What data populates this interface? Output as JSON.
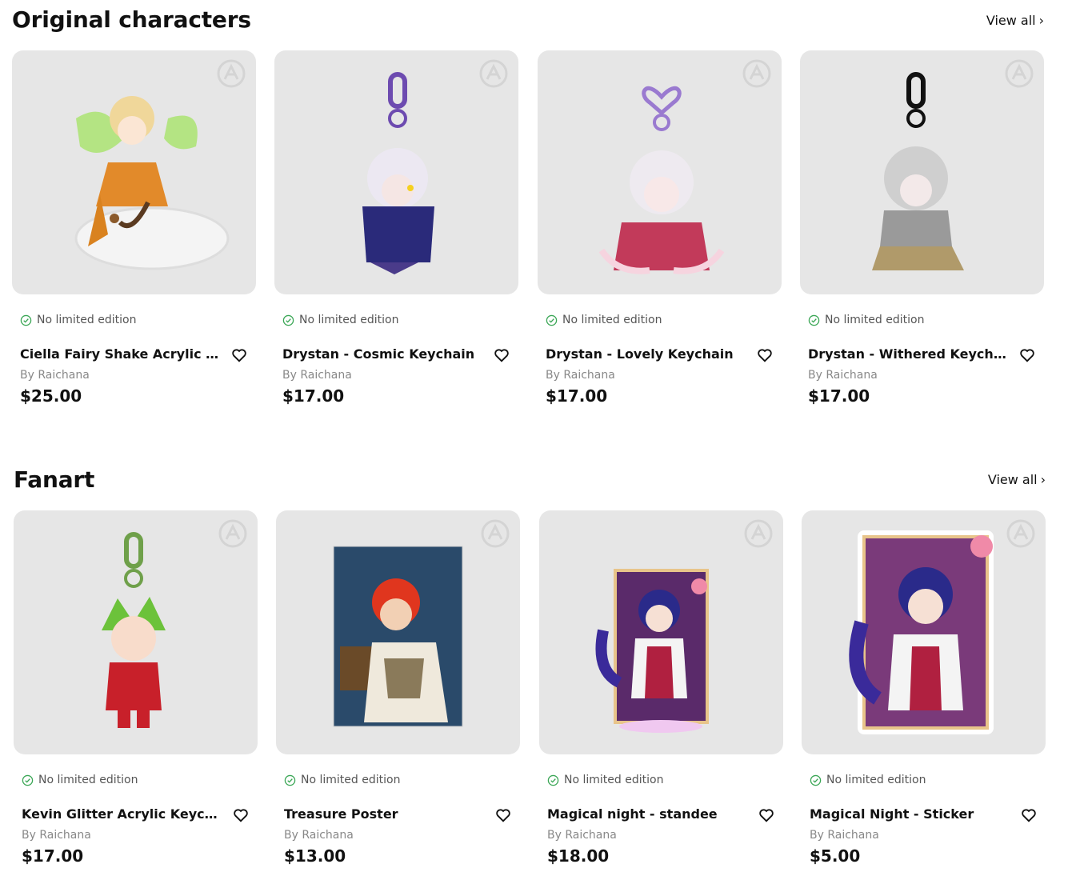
{
  "sections": [
    {
      "title": "Original characters",
      "view_all": "View all",
      "products": [
        {
          "edition": "No limited edition",
          "title": "Ciella Fairy Shake Acrylic St...",
          "by": "By Raichana",
          "price": "$25.00"
        },
        {
          "edition": "No limited edition",
          "title": "Drystan - Cosmic Keychain",
          "by": "By Raichana",
          "price": "$17.00"
        },
        {
          "edition": "No limited edition",
          "title": "Drystan - Lovely Keychain",
          "by": "By Raichana",
          "price": "$17.00"
        },
        {
          "edition": "No limited edition",
          "title": "Drystan - Withered Keychain",
          "by": "By Raichana",
          "price": "$17.00"
        }
      ]
    },
    {
      "title": "Fanart",
      "view_all": "View all",
      "products": [
        {
          "edition": "No limited edition",
          "title": "Kevin Glitter Acrylic Keychai...",
          "by": "By Raichana",
          "price": "$17.00"
        },
        {
          "edition": "No limited edition",
          "title": "Treasure Poster",
          "by": "By Raichana",
          "price": "$13.00"
        },
        {
          "edition": "No limited edition",
          "title": "Magical night - standee",
          "by": "By Raichana",
          "price": "$18.00"
        },
        {
          "edition": "No limited edition",
          "title": "Magical Night - Sticker",
          "by": "By Raichana",
          "price": "$5.00"
        }
      ]
    }
  ],
  "icons": {
    "edition_check": "check-circle-icon",
    "favorite": "heart-icon",
    "brand_badge": "brand-logo-icon",
    "view_all_arrow": "chevron-right-icon"
  },
  "colors": {
    "check_green": "#3aa655",
    "card_bg": "#e6e6e6",
    "text_primary": "#111111",
    "text_secondary": "#888888"
  }
}
